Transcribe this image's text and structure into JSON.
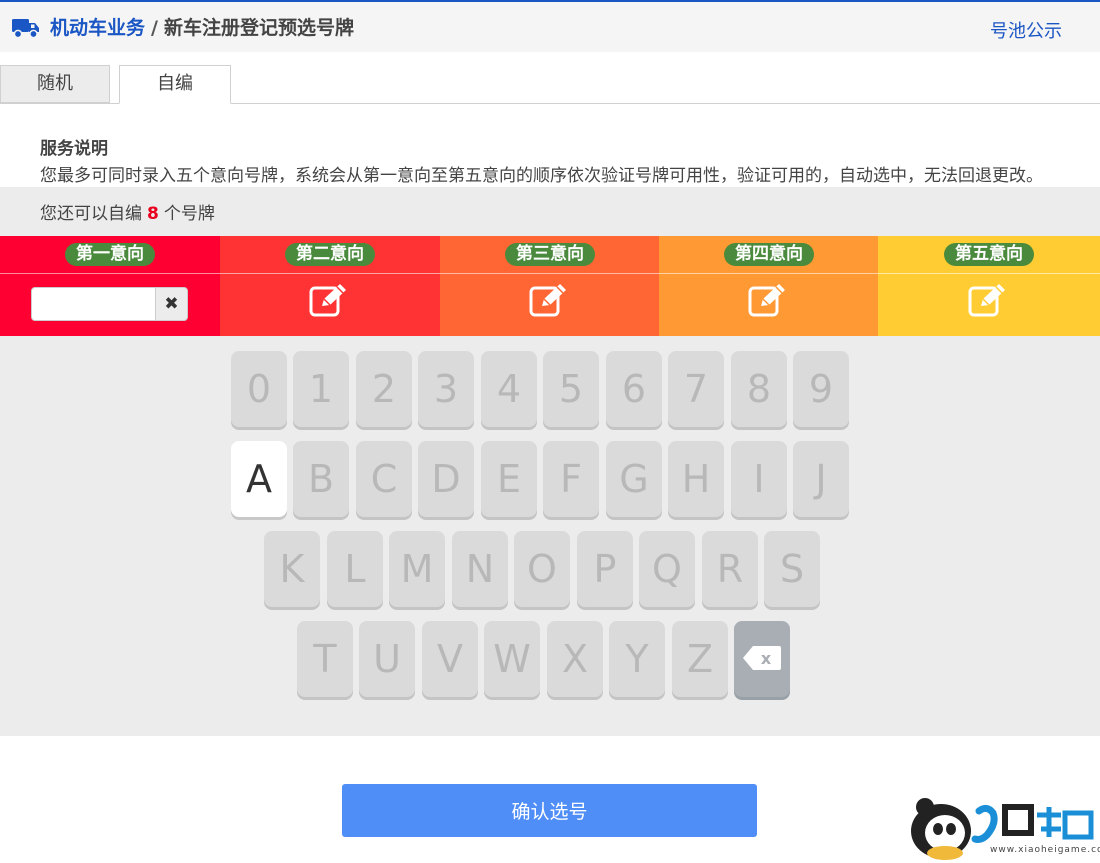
{
  "header": {
    "truck_icon": "truck-icon",
    "breadcrumb_main": "机动车业务",
    "breadcrumb_sep": "/",
    "breadcrumb_sub": "新车注册登记预选号牌",
    "pool_link": "号池公示",
    "accent": "#1a56c4"
  },
  "tabs": [
    {
      "label": "随机",
      "active": false
    },
    {
      "label": "自编",
      "active": true
    }
  ],
  "service": {
    "title": "服务说明",
    "description": "您最多可同时录入五个意向号牌，系统会从第一意向至第五意向的顺序依次验证号牌可用性，验证可用的，自动选中，无法回退更改。"
  },
  "remain": {
    "prefix": "您还可以自编",
    "count": "8",
    "suffix": "个号牌"
  },
  "choices": [
    {
      "label": "第一意向",
      "color": "#ff0033",
      "input_value": "",
      "clear": "✖"
    },
    {
      "label": "第二意向",
      "color": "#ff3333",
      "icon": "edit-icon"
    },
    {
      "label": "第三意向",
      "color": "#ff6633",
      "icon": "edit-icon"
    },
    {
      "label": "第四意向",
      "color": "#ff9933",
      "icon": "edit-icon"
    },
    {
      "label": "第五意向",
      "color": "#ffcc33",
      "icon": "edit-icon"
    }
  ],
  "keyboard": {
    "row1": [
      "0",
      "1",
      "2",
      "3",
      "4",
      "5",
      "6",
      "7",
      "8",
      "9"
    ],
    "row2": [
      "A",
      "B",
      "C",
      "D",
      "E",
      "F",
      "G",
      "H",
      "I",
      "J"
    ],
    "row3": [
      "K",
      "L",
      "M",
      "N",
      "O",
      "P",
      "Q",
      "R",
      "S"
    ],
    "row4": [
      "T",
      "U",
      "V",
      "W",
      "X",
      "Y",
      "Z"
    ],
    "active_key": "A",
    "delete_icon": "backspace-icon",
    "delete_glyph": "x"
  },
  "confirm_label": "确认选号",
  "watermark": {
    "text": "www.xiaoheigame.com",
    "logo": "panda-logo-icon"
  }
}
